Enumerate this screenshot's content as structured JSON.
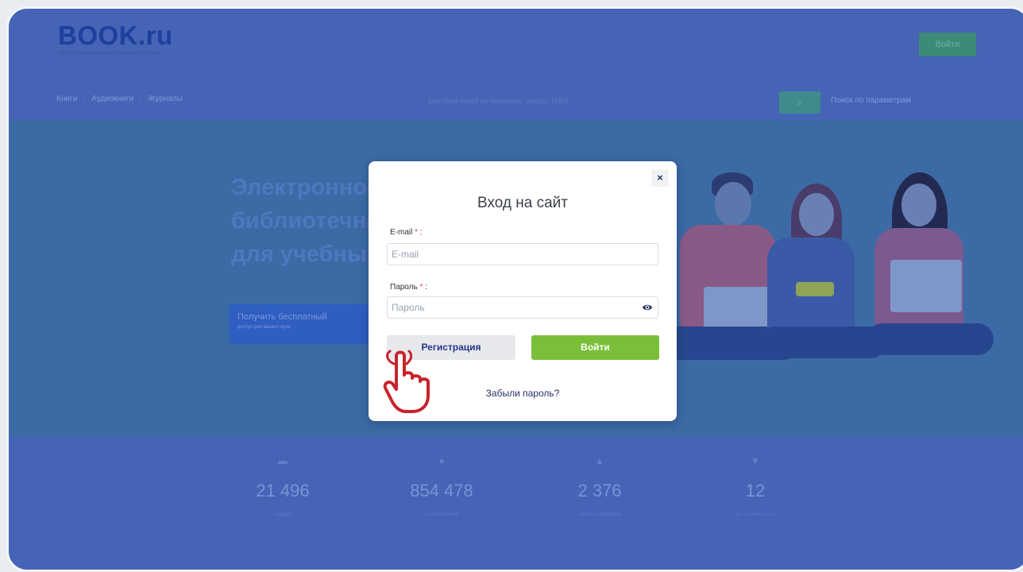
{
  "header": {
    "logo_title": "BOOK.ru",
    "logo_tagline": "ЭЛЕКТРОННО-БИБЛИОТЕЧНАЯ СИСТЕМА",
    "login_button": "Войти",
    "nav": [
      "Книги",
      "Аудиокниги",
      "Журналы"
    ],
    "search_placeholder": "Быстрый поиск по названию, автору, ISBN",
    "search_icon": "search-icon",
    "param_search": "Поиск по параметрам"
  },
  "hero": {
    "title_lines": [
      "Электронно-",
      "библиотечна",
      "для учебных"
    ],
    "button_label": "Получить бесплатный",
    "button_sub": "доступ для вашего вуза"
  },
  "stats": [
    {
      "icon": "book-icon",
      "value": "21 496",
      "label": "изданий"
    },
    {
      "icon": "user-icon",
      "value": "854 478",
      "label": "пользователей"
    },
    {
      "icon": "building-icon",
      "value": "2 376",
      "label": "учебных заведений"
    },
    {
      "icon": "trophy-icon",
      "value": "12",
      "label": "лет на рынке услуг"
    }
  ],
  "modal": {
    "close_label": "×",
    "title": "Вход на сайт",
    "email_label": "E-mail",
    "email_placeholder": "E-mail",
    "password_label": "Пароль",
    "password_placeholder": "Пароль",
    "required_mark": "*",
    "label_suffix": " :",
    "register_label": "Регистрация",
    "login_label": "Войти",
    "forgot_label": "Забыли пароль?"
  },
  "colors": {
    "overlay": "#4564b6",
    "login_green": "#7abf3a",
    "register_text": "#27358a",
    "hand_cursor": "#c8232c"
  }
}
